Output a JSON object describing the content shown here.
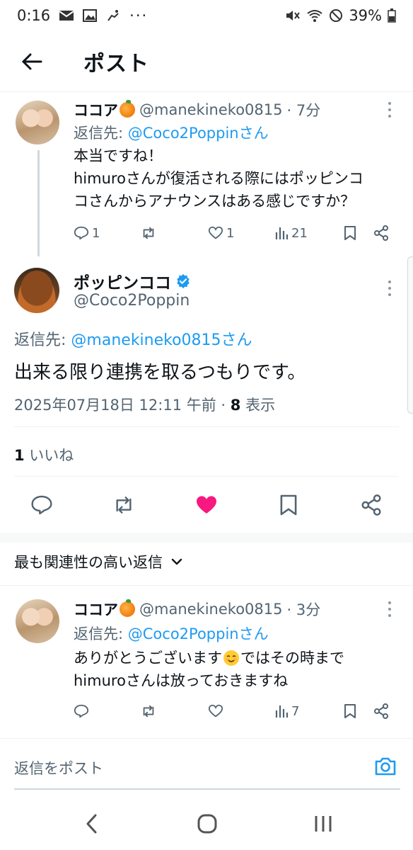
{
  "status_bar": {
    "time": "0:16",
    "battery": "39%"
  },
  "header": {
    "title": "ポスト"
  },
  "reply1": {
    "name": "ココア",
    "handle": "@manekineko0815",
    "time": "· 7分",
    "reply_prefix": "返信先:",
    "reply_target": "@Coco2Poppinさん",
    "text_line1": "本当ですね！",
    "text_line2": "himuroさんが復活される際にはポッピンコ",
    "text_line3": "コさんからアナウンスはある感じですか？",
    "replies": "1",
    "likes": "1",
    "views": "21"
  },
  "main_tweet": {
    "name": "ポッピンココ",
    "handle": "@Coco2Poppin",
    "reply_prefix": "返信先:",
    "reply_target": "@manekineko0815さん",
    "text": "出来る限り連携を取るつもりです。",
    "datetime": "2025年07月18日 12:11 午前 · ",
    "views_count": "8",
    "views_label": " 表示",
    "likes_count": "1",
    "likes_label": " いいね"
  },
  "sort": {
    "label": "最も関連性の高い返信"
  },
  "reply2": {
    "name": "ココア",
    "handle": "@manekineko0815",
    "time": "· 3分",
    "reply_prefix": "返信先:",
    "reply_target": "@Coco2Poppinさん",
    "text_line1a": "ありがとうございます",
    "text_line1b": "ではその時まで",
    "text_line2": "himuroさんは放っておきますね",
    "views": "7"
  },
  "compose": {
    "placeholder": "返信をポスト"
  },
  "colors": {
    "accent": "#1d9bf0",
    "like": "#f91880",
    "text": "#0f1419",
    "muted": "#536471"
  }
}
